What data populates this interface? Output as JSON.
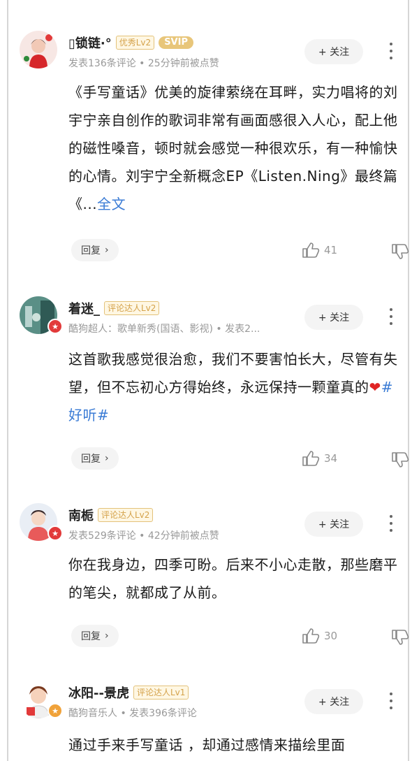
{
  "comments": [
    {
      "username": "▯锁链·°",
      "badges": [
        "优秀Lv2",
        "SVIP"
      ],
      "meta": "发表136条评论 • 25分钟前被点赞",
      "follow_label": "+ 关注",
      "text": "《手写童话》优美的旋律萦绕在耳畔，实力唱将的刘宇宁亲自创作的歌词非常有画面感很入人心，配上他的磁性嗓音，顿时就会感觉一种很欢乐，有一种愉快的心情。刘宇宁全新概念EP《Listen.Ning》最终篇《...",
      "full_text_link": "全文",
      "reply_label": "回复",
      "likes": "41"
    },
    {
      "username": "着迷_",
      "badges": [
        "评论达人Lv2"
      ],
      "meta": "酷狗超人：歌单新秀(国语、影视) • 发表2...",
      "follow_label": "+ 关注",
      "text": "这首歌我感觉很治愈，我们不要害怕长大，尽管有失望，但不忘初心方得始终，永远保持一颗童真的",
      "hashtag": "#好听#",
      "reply_label": "回复",
      "likes": "34"
    },
    {
      "username": "南栀",
      "badges": [
        "评论达人Lv2"
      ],
      "meta": "发表529条评论 • 42分钟前被点赞",
      "follow_label": "+ 关注",
      "text": "你在我身边，四季可盼。后来不小心走散，那些磨平的笔尖，就都成了从前。",
      "reply_label": "回复",
      "likes": "30"
    },
    {
      "username": "冰阳--景虎",
      "badges": [
        "评论达人Lv1"
      ],
      "meta": "酷狗音乐人 • 发表396条评论",
      "follow_label": "+ 关注",
      "text": "通过手来手写童话 ，却通过感情来描绘里面"
    }
  ],
  "colors": {
    "accent_link": "#3a7bd5",
    "badge_gold": "#d4a24a",
    "vip_red": "#e23a3a"
  }
}
